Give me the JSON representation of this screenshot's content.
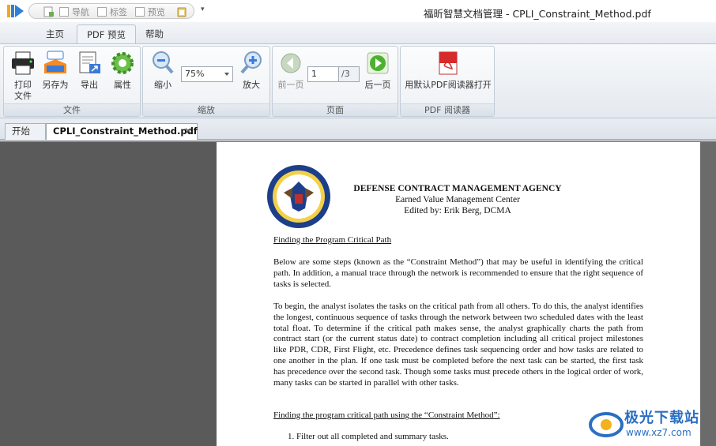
{
  "window": {
    "title": "福昕智慧文档管理 - CPLI_Constraint_Method.pdf"
  },
  "quick_access": {
    "nav_label": "导航",
    "bookmark_label": "标签",
    "preview_label": "预览"
  },
  "ribbon_tabs": [
    {
      "label": "主页"
    },
    {
      "label": "PDF 预览"
    },
    {
      "label": "帮助"
    }
  ],
  "ribbon": {
    "file_group": {
      "label": "文件",
      "print_line1": "打印",
      "print_line2": "文件",
      "saveas": "另存为",
      "export": "导出",
      "properties": "属性"
    },
    "zoom_group": {
      "label": "缩放",
      "zoom_out": "缩小",
      "zoom_in": "放大",
      "zoom_value": "75%"
    },
    "page_group": {
      "label": "页面",
      "prev": "前一页",
      "next": "后一页",
      "current": "1",
      "total": "/3"
    },
    "reader_group": {
      "label": "PDF 阅读器",
      "open_default": "用默认PDF阅读器打开"
    }
  },
  "doc_tabs": {
    "start": "开始",
    "document": "CPLI_Constraint_Method.pdf",
    "close": "✕"
  },
  "document": {
    "agency": "DEFENSE CONTRACT MANAGEMENT AGENCY",
    "center": "Earned Value Management Center",
    "editor": "Edited by: Erik Berg, DCMA",
    "heading1": "Finding the Program Critical Path",
    "para1": "Below are some steps (known as the “Constraint Method”) that may be useful in identifying the critical path. In addition, a manual trace through the network is recommended to ensure that the right sequence of tasks is selected.",
    "para2": "To begin, the analyst isolates the tasks on the critical path from all others. To do this, the analyst identifies the longest, continuous sequence of tasks through the network between two scheduled dates with the least total float. To determine if the critical path makes sense, the analyst graphically charts the path from contract start (or the current status date) to contract completion including all critical project milestones like PDR, CDR, First Flight, etc. Precedence defines task sequencing order and how tasks are related to one another in the plan. If one task must be completed before the next task can be started, the first task has precedence over the second task. Though some tasks must precede others in the logical order of work, many tasks can be started in parallel with other tasks.",
    "heading2": "Finding the program critical path using the “Constraint Method”:",
    "list_item1": "1.   Filter out all completed and summary tasks."
  },
  "watermark": {
    "text": "极光下载站",
    "url": "www.xz7.com"
  }
}
